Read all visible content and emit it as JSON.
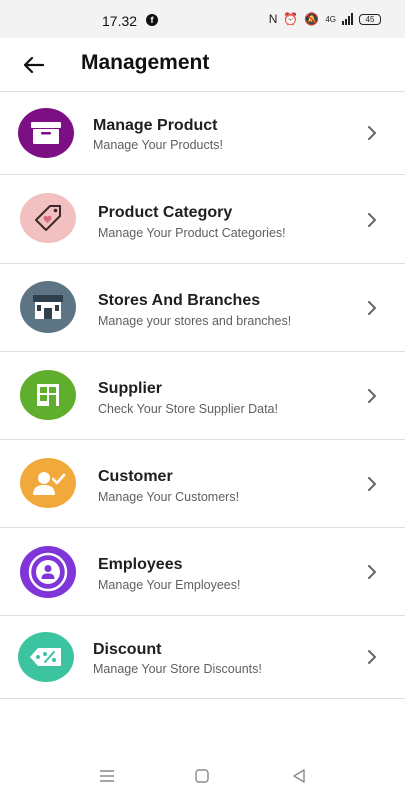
{
  "status_bar": {
    "time": "17.32",
    "battery": "45",
    "network": "4G"
  },
  "header": {
    "title": "Management"
  },
  "menu": [
    {
      "title": "Manage Product",
      "subtitle": "Manage Your Products!",
      "icon": "archive-box-icon",
      "color": "#7b0f83"
    },
    {
      "title": "Product Category",
      "subtitle": "Manage Your Product Categories!",
      "icon": "tag-heart-icon",
      "color": "#f3c0c1"
    },
    {
      "title": "Stores And Branches",
      "subtitle": "Manage your stores and branches!",
      "icon": "store-icon",
      "color": "#5c7484"
    },
    {
      "title": "Supplier",
      "subtitle": "Check Your Store Supplier Data!",
      "icon": "building-icon",
      "color": "#5fae2e"
    },
    {
      "title": "Customer",
      "subtitle": "Manage Your Customers!",
      "icon": "user-check-icon",
      "color": "#f2a93b"
    },
    {
      "title": "Employees",
      "subtitle": "Manage Your Employees!",
      "icon": "person-badge-icon",
      "color": "#7f35d8"
    },
    {
      "title": "Discount",
      "subtitle": "Manage Your Store Discounts!",
      "icon": "discount-tag-icon",
      "color": "#3cc3a0"
    }
  ],
  "nav": {
    "icons": [
      "menu-icon",
      "home-square-icon",
      "back-triangle-icon"
    ]
  }
}
